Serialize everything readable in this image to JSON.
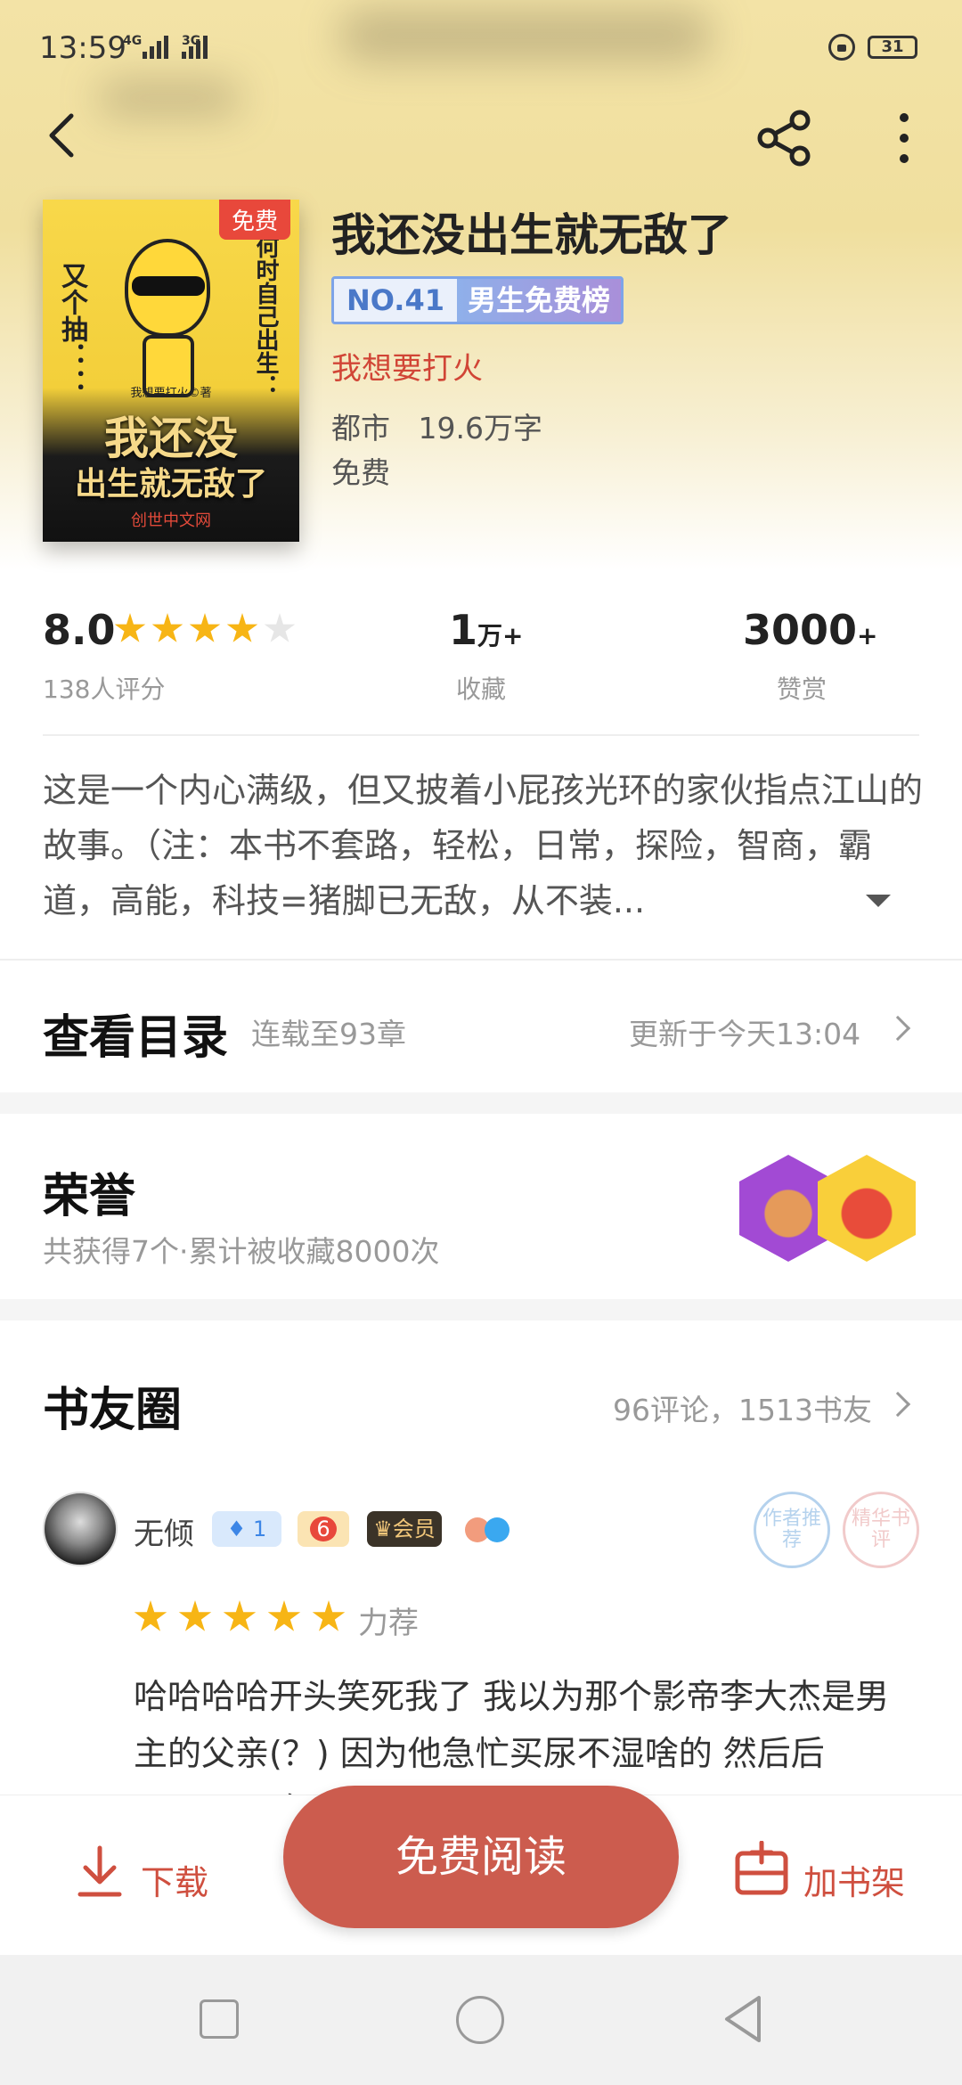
{
  "status_bar": {
    "time": "13:59",
    "net1": "4G",
    "net2": "3G",
    "battery": "31"
  },
  "book": {
    "title": "我还没出生就无敌了",
    "cover_badge": "免费",
    "cover_title_line1": "我还没",
    "cover_title_line2": "出生就无敌了",
    "cover_small_text": "我想要打火©著",
    "cover_publisher": "创世中文网",
    "cover_side_left": "又个抽：：",
    "cover_side_right": "何时自己出生：",
    "rank_number": "NO.41",
    "rank_label": "男生免费榜",
    "author": "我想要打火",
    "category": "都市",
    "word_count": "19.6万字",
    "price": "免费"
  },
  "stats": {
    "score": "8.0",
    "rating_stars": 4,
    "rating_count": "138人评分",
    "favorites_value": "1",
    "favorites_unit": "万+",
    "favorites_label": "收藏",
    "rewards_value": "3000",
    "rewards_unit": "+",
    "rewards_label": "赞赏"
  },
  "description": "这是一个内心满级，但又披着小屁孩光环的家伙指点江山的故事。（注：本书不套路，轻松，日常，探险，智商，霸道，高能，科技=猪脚已无敌，从不装...",
  "catalog": {
    "title": "查看目录",
    "progress": "连载至93章",
    "updated": "更新于今天13:04"
  },
  "honor": {
    "title": "荣誉",
    "subtitle": "共获得7个·累计被收藏8000次"
  },
  "circle": {
    "title": "书友圈",
    "stats": "96评论，1513书友",
    "comment": {
      "username": "无倾",
      "fire_level": "1",
      "medal_level": "6",
      "vip_label": "会员",
      "stamp1": "作者推荐",
      "stamp2": "精华书评",
      "stars": 5,
      "recommend": "力荐",
      "text": "哈哈哈哈开头笑死我了 我以为那个影帝李大杰是男主的父亲(？) 因为他急忙买尿不湿啥的 然后后面？？？ 每一个人都"
    }
  },
  "bottom": {
    "download": "下载",
    "read": "免费阅读",
    "shelf": "加书架"
  },
  "colors": {
    "accent": "#cc5c4e",
    "star": "#f7b515",
    "rank_blue": "#7da4e8"
  }
}
